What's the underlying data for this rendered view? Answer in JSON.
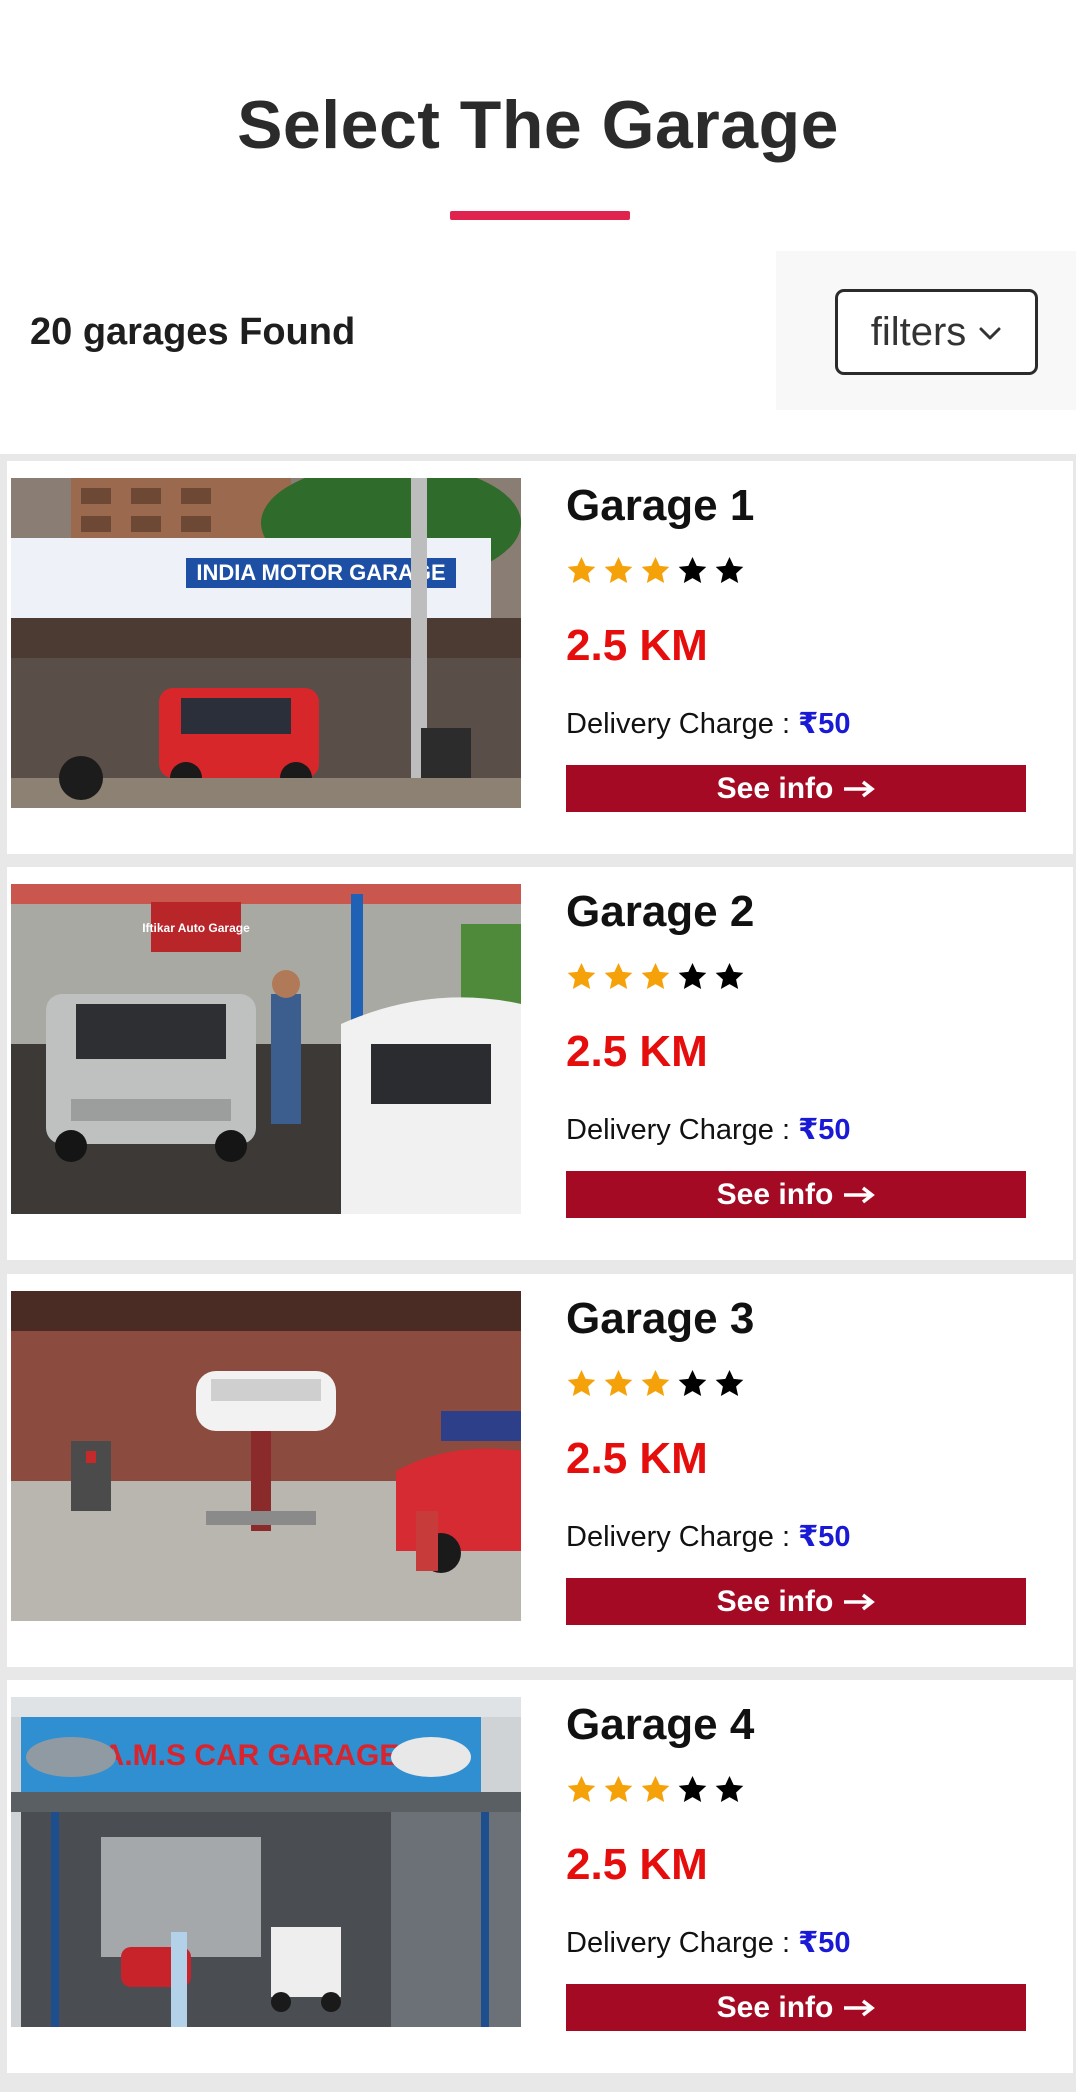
{
  "header": {
    "title": "Select The Garage",
    "accent_color": "#e0234e"
  },
  "toolbar": {
    "count_text": "20 garages Found",
    "filters_label": "filters",
    "filters_icon": "chevron-down-icon"
  },
  "garages": [
    {
      "name": "Garage 1",
      "rating": 3,
      "max_rating": 5,
      "distance": "2.5 KM",
      "delivery_label": "Delivery Charge : ",
      "delivery_amount": "₹50",
      "button_label": "See info",
      "photo_signboard": "INDIA MOTOR GARAGE"
    },
    {
      "name": "Garage 2",
      "rating": 3,
      "max_rating": 5,
      "distance": "2.5 KM",
      "delivery_label": "Delivery Charge : ",
      "delivery_amount": "₹50",
      "button_label": "See info",
      "photo_signboard": "Iftikar Auto Garage"
    },
    {
      "name": "Garage 3",
      "rating": 3,
      "max_rating": 5,
      "distance": "2.5 KM",
      "delivery_label": "Delivery Charge : ",
      "delivery_amount": "₹50",
      "button_label": "See info",
      "photo_signboard": ""
    },
    {
      "name": "Garage 4",
      "rating": 3,
      "max_rating": 5,
      "distance": "2.5 KM",
      "delivery_label": "Delivery Charge : ",
      "delivery_amount": "₹50",
      "button_label": "See info",
      "photo_signboard": "A.M.S CAR GARAGE"
    }
  ],
  "colors": {
    "star_filled": "#f5a20a",
    "star_empty": "#000000",
    "distance": "#e60d0d",
    "price": "#1a1ad6",
    "button_bg": "#a50a24"
  }
}
